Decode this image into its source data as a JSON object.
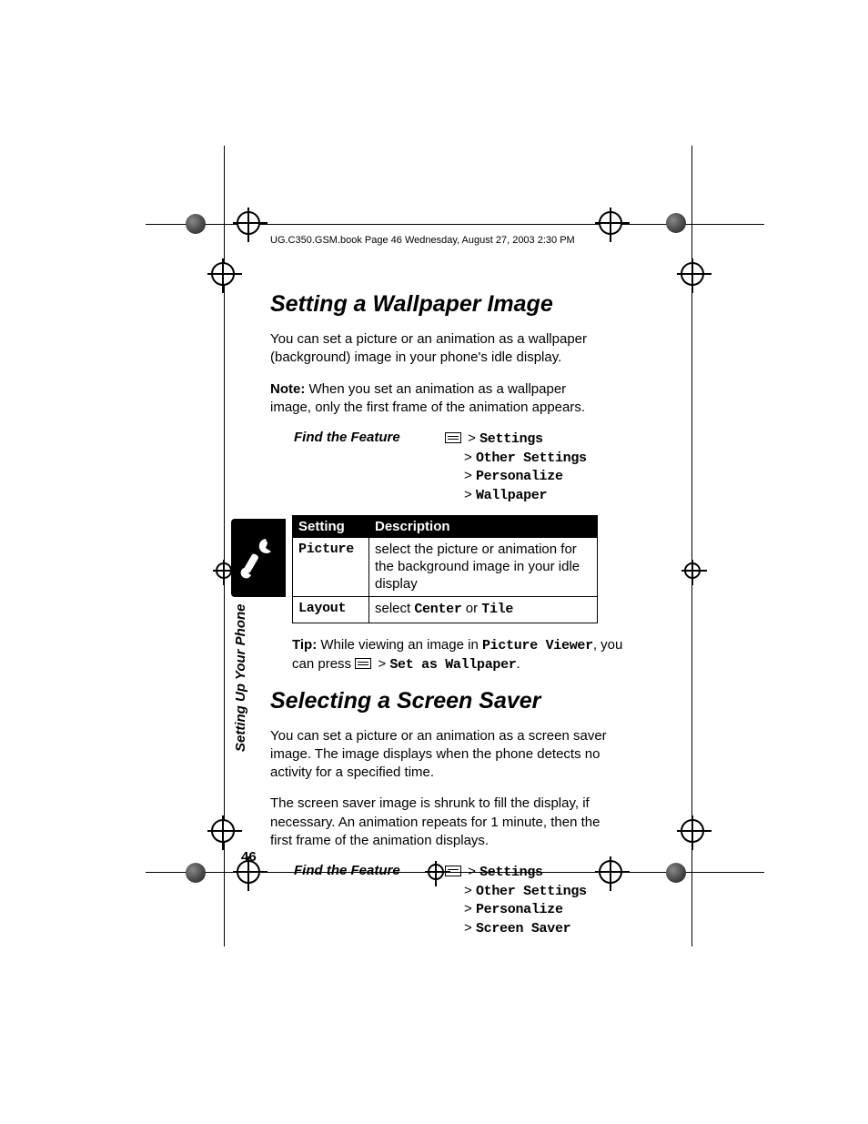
{
  "docheader": "UG.C350.GSM.book  Page 46  Wednesday, August 27, 2003  2:30 PM",
  "section1": {
    "title": "Setting a Wallpaper Image",
    "p1": "You can set a picture or an animation as a wallpaper (background) image in your phone's idle display.",
    "note_label": "Note:",
    "note_text": " When you set an animation as a wallpaper image, only the first frame of the animation appears.",
    "find_label": "Find the Feature",
    "path_gt": " > ",
    "path_l1": "Settings",
    "path_l2": "Other Settings",
    "path_l3": "Personalize",
    "path_l4": "Wallpaper",
    "table": {
      "h1": "Setting",
      "h2": "Description",
      "r1c1": "Picture",
      "r1c2": "select the picture or animation for the background image in your idle display",
      "r2c1": "Layout",
      "r2c2a": "select ",
      "r2c2b": "Center",
      "r2c2c": " or ",
      "r2c2d": "Tile"
    },
    "tip_label": "Tip:",
    "tip_a": " While viewing an image in ",
    "tip_b": "Picture Viewer",
    "tip_c": ", you can press ",
    "tip_d": " > ",
    "tip_e": "Set as Wallpaper",
    "tip_f": "."
  },
  "section2": {
    "title": "Selecting a Screen Saver",
    "p1": "You can set a picture or an animation as a screen saver image. The image displays when the phone detects no activity for a specified time.",
    "p2": "The screen saver image is shrunk to fill the display, if necessary. An animation repeats for 1 minute, then the first frame of the animation displays.",
    "find_label": "Find the Feature",
    "path_l1": "Settings",
    "path_l2": "Other Settings",
    "path_l3": "Personalize",
    "path_l4": "Screen Saver"
  },
  "side_label": "Setting Up Your Phone",
  "page_number": "46"
}
